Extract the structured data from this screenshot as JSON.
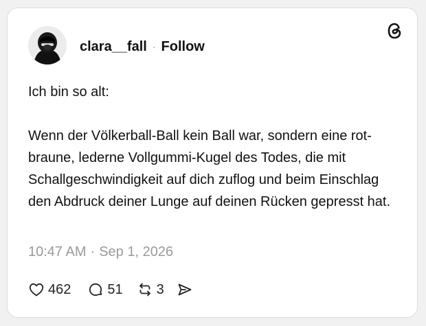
{
  "post": {
    "username": "clara__fall",
    "separator": "·",
    "follow_label": "Follow",
    "paragraphs": [
      "Ich bin so alt:",
      "Wenn der Völkerball-Ball kein Ball war, sondern eine rot-braune, lederne Vollgummi-Kugel des Todes, die mit Schallgeschwindigkeit auf dich zuflog und beim Einschlag den Abdruck deiner Lunge auf deinen Rücken gepresst hat."
    ],
    "time": "10:47 AM",
    "time_separator": "·",
    "date": "Sep 1, 2026"
  },
  "stats": {
    "likes": "462",
    "replies": "51",
    "reposts": "3"
  },
  "icons": {
    "brand": "threads-logo-icon",
    "like": "heart-icon",
    "reply": "comment-bubble-icon",
    "repost": "repost-icon",
    "share": "send-icon"
  },
  "colors": {
    "text": "#111111",
    "muted": "#9a9a9a",
    "card_bg": "#ffffff",
    "page_bg": "#f1f1f1"
  }
}
